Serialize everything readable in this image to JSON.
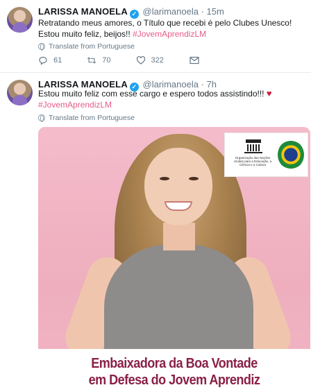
{
  "tweets": [
    {
      "name": "LARISSA MANOELA",
      "verified_glyph": "✓",
      "handle": "@larimanoela",
      "separator": "·",
      "time": "15m",
      "text": "Retratando meus amores, o Título que recebi é pelo Clubes Unesco! Estou muito feliz, beijos!! ",
      "hashtag": "#JovemAprendizLM",
      "translate_label": "Translate from Portuguese",
      "actions": {
        "replies": "61",
        "retweets": "70",
        "likes": "322"
      }
    },
    {
      "name": "LARISSA MANOELA",
      "verified_glyph": "✓",
      "handle": "@larimanoela",
      "separator": "·",
      "time": "7h",
      "text": "Estou muito feliz com esse cargo e espero todos assistindo!!! ",
      "heart": "♥",
      "hashtag": "#JovemAprendizLM",
      "translate_label": "Translate from Portuguese",
      "media": {
        "logo_text": "Organização das Nações Unidas para a Educação, a Ciência e a Cultura",
        "caption_line_1": "Embaixadora da Boa Vontade",
        "caption_line_2": "em Defesa do Jovem Aprendiz"
      }
    }
  ],
  "colors": {
    "hashtag": "#e0245e",
    "verified": "#1da1f2",
    "caption": "#8a2046",
    "photo_background": "#f2b6c4"
  },
  "icons": [
    "reply-icon",
    "retweet-icon",
    "like-icon",
    "message-icon",
    "globe-icon",
    "verified-icon"
  ]
}
